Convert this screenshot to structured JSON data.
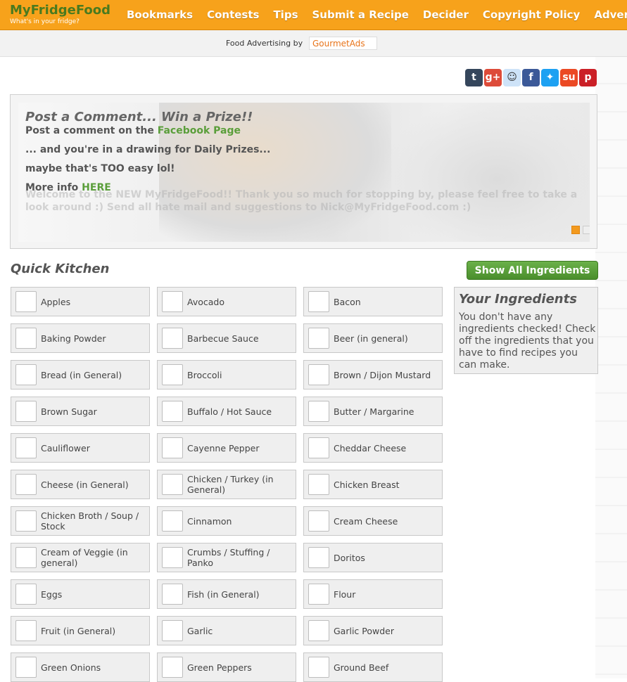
{
  "header": {
    "brand_name": "MyFridgeFood",
    "brand_tagline": "What's in your fridge?",
    "nav": [
      "Bookmarks",
      "Contests",
      "Tips",
      "Submit a Recipe",
      "Decider",
      "Copyright Policy",
      "Advertise"
    ]
  },
  "ad_bar": {
    "label": "Food Advertising by",
    "logo_text": "GourmetAds"
  },
  "social": [
    {
      "name": "tumblr-icon",
      "glyph": "t",
      "color": "#35465c"
    },
    {
      "name": "google-plus-icon",
      "glyph": "g+",
      "color": "#dd4b39"
    },
    {
      "name": "reddit-icon",
      "glyph": "☺",
      "color": "#cee3f8"
    },
    {
      "name": "facebook-icon",
      "glyph": "f",
      "color": "#3b5998"
    },
    {
      "name": "twitter-icon",
      "glyph": "✦",
      "color": "#1da1f2"
    },
    {
      "name": "stumbleupon-icon",
      "glyph": "su",
      "color": "#eb4924"
    },
    {
      "name": "pinterest-icon",
      "glyph": "p",
      "color": "#cb2027"
    }
  ],
  "slider": {
    "title": "Post a Comment... Win a Prize!!",
    "line1_prefix": "Post a comment on the ",
    "line1_link": "Facebook Page",
    "line2": "... and you're in a drawing for Daily Prizes...",
    "line3": "maybe that's TOO easy lol!",
    "line4_prefix": "More info ",
    "line4_link": "HERE",
    "faded_text": "Welcome to the NEW MyFridgeFood!!  Thank you so much for stopping by, please feel free to take a look around :)  Send all hate mail and suggestions to Nick@MyFridgeFood.com :)"
  },
  "quick_kitchen": {
    "title": "Quick Kitchen",
    "show_all_label": "Show All Ingredients",
    "ingredients": [
      "Apples",
      "Avocado",
      "Bacon",
      "Baking Powder",
      "Barbecue Sauce",
      "Beer (in general)",
      "Bread (in General)",
      "Broccoli",
      "Brown / Dijon Mustard",
      "Brown Sugar",
      "Buffalo / Hot Sauce",
      "Butter / Margarine",
      "Cauliflower",
      "Cayenne Pepper",
      "Cheddar Cheese",
      "Cheese (in General)",
      "Chicken / Turkey (in General)",
      "Chicken Breast",
      "Chicken Broth / Soup / Stock",
      "Cinnamon",
      "Cream Cheese",
      "Cream of Veggie (in general)",
      "Crumbs / Stuffing / Panko",
      "Doritos",
      "Eggs",
      "Fish (in General)",
      "Flour",
      "Fruit (in General)",
      "Garlic",
      "Garlic Powder",
      "Green Onions",
      "Green Peppers",
      "Ground Beef"
    ]
  },
  "your_ingredients": {
    "title": "Your Ingredients",
    "text": "You don't have any ingredients checked! Check off the ingredients that you have to find recipes you can make."
  }
}
